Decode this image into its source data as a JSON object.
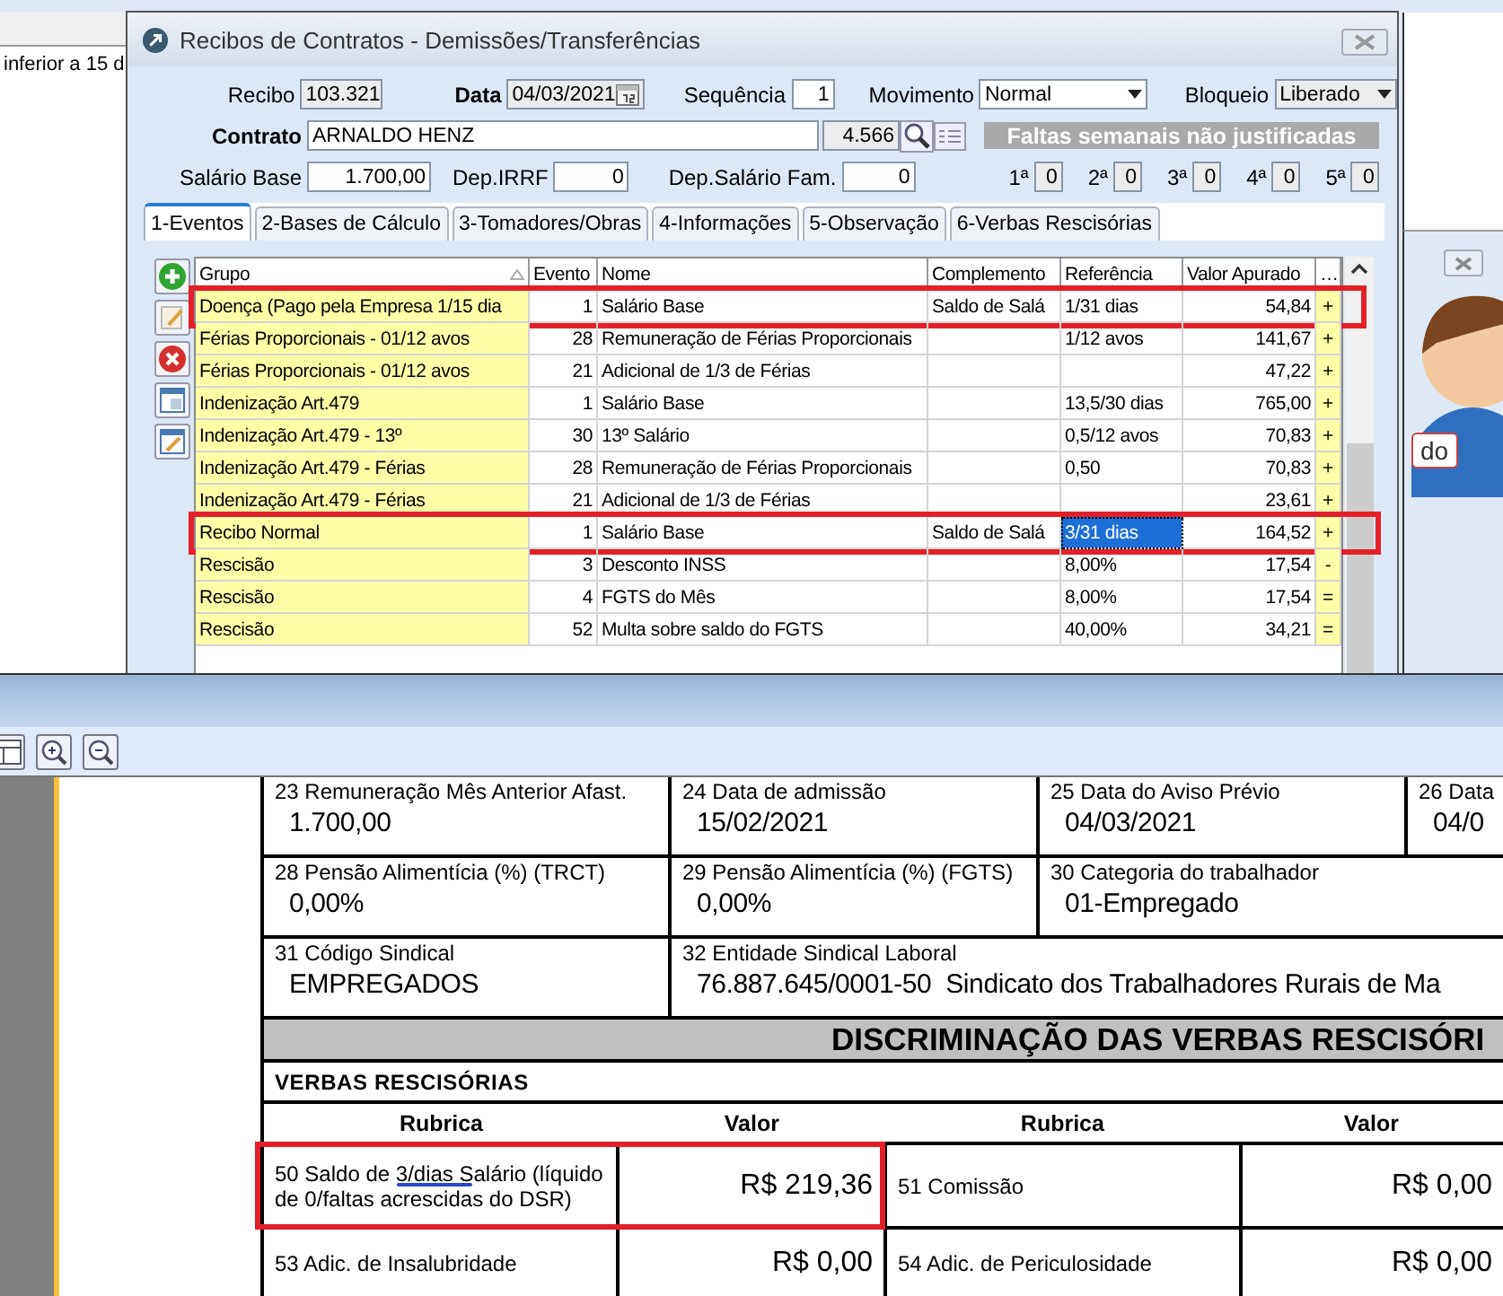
{
  "background_app": {
    "row_text": "inferior a 15 d",
    "badge_text": "do"
  },
  "dialog": {
    "title": "Recibos de Contratos - Demissões/Transferências",
    "recibo": {
      "label": "Recibo",
      "value": "103.321"
    },
    "data": {
      "label": "Data",
      "value": "04/03/2021"
    },
    "sequencia": {
      "label": "Sequência",
      "value": "1"
    },
    "movimento": {
      "label": "Movimento",
      "value": "Normal"
    },
    "bloqueio": {
      "label": "Bloqueio",
      "value": "Liberado"
    },
    "contrato": {
      "label": "Contrato",
      "value": "ARNALDO HENZ",
      "code": "4.566"
    },
    "salario_base": {
      "label": "Salário Base",
      "value": "1.700,00"
    },
    "dep_irrf": {
      "label": "Dep.IRRF",
      "value": "0"
    },
    "dep_salario_fam": {
      "label": "Dep.Salário Fam.",
      "value": "0"
    },
    "faltas": {
      "title": "Faltas semanais não justificadas",
      "weeks": [
        {
          "label": "1ª",
          "value": "0"
        },
        {
          "label": "2ª",
          "value": "0"
        },
        {
          "label": "3ª",
          "value": "0"
        },
        {
          "label": "4ª",
          "value": "0"
        },
        {
          "label": "5ª",
          "value": "0"
        }
      ]
    },
    "tabs": [
      {
        "label": "1-Eventos",
        "selected": true
      },
      {
        "label": "2-Bases de Cálculo",
        "selected": false
      },
      {
        "label": "3-Tomadores/Obras",
        "selected": false
      },
      {
        "label": "4-Informações",
        "selected": false
      },
      {
        "label": "5-Observação",
        "selected": false
      },
      {
        "label": "6-Verbas Rescisórias",
        "selected": false
      }
    ],
    "grid": {
      "columns": [
        "Grupo",
        "Evento",
        "Nome",
        "Complemento",
        "Referência",
        "Valor Apurado",
        "…"
      ],
      "rows": [
        {
          "grupo": "Doença (Pago pela Empresa 1/15 dia",
          "evento": "1",
          "nome": "Salário Base",
          "complemento": "Saldo de Salá",
          "referencia": "1/31 dias",
          "valor": "54,84",
          "sinal": "+",
          "highlighted": true,
          "selected": false
        },
        {
          "grupo": "Férias Proporcionais - 01/12 avos",
          "evento": "28",
          "nome": "Remuneração de Férias Proporcionais",
          "referencia": "1/12 avos",
          "valor": "141,67",
          "sinal": "+",
          "highlighted": false,
          "selected": false
        },
        {
          "grupo": "Férias Proporcionais - 01/12 avos",
          "evento": "21",
          "nome": "Adicional de 1/3 de Férias",
          "valor": "47,22",
          "sinal": "+",
          "highlighted": false,
          "selected": false
        },
        {
          "grupo": "Indenização Art.479",
          "evento": "1",
          "nome": "Salário Base",
          "referencia": "13,5/30 dias",
          "valor": "765,00",
          "sinal": "+",
          "highlighted": false,
          "selected": false
        },
        {
          "grupo": "Indenização Art.479 - 13º",
          "evento": "30",
          "nome": "13º Salário",
          "referencia": "0,5/12 avos",
          "valor": "70,83",
          "sinal": "+",
          "highlighted": false,
          "selected": false
        },
        {
          "grupo": "Indenização Art.479 - Férias",
          "evento": "28",
          "nome": "Remuneração de Férias Proporcionais",
          "referencia": "0,50",
          "valor": "70,83",
          "sinal": "+",
          "highlighted": false,
          "selected": false
        },
        {
          "grupo": "Indenização Art.479 - Férias",
          "evento": "21",
          "nome": "Adicional de 1/3 de Férias",
          "valor": "23,61",
          "sinal": "+",
          "highlighted": false,
          "selected": false
        },
        {
          "grupo": "Recibo Normal",
          "evento": "1",
          "nome": "Salário Base",
          "complemento": "Saldo de Salá",
          "referencia": "3/31 dias",
          "valor": "164,52",
          "sinal": "+",
          "highlighted": true,
          "selected": true
        },
        {
          "grupo": "Rescisão",
          "evento": "3",
          "nome": "Desconto INSS",
          "referencia": "8,00%",
          "valor": "17,54",
          "sinal": "-",
          "highlighted": false,
          "selected": false
        },
        {
          "grupo": "Rescisão",
          "evento": "4",
          "nome": "FGTS do Mês",
          "referencia": "8,00%",
          "valor": "17,54",
          "sinal": "=",
          "highlighted": false,
          "selected": false
        },
        {
          "grupo": "Rescisão",
          "evento": "52",
          "nome": "Multa sobre saldo do FGTS",
          "referencia": "40,00%",
          "valor": "34,21",
          "sinal": "=",
          "highlighted": false,
          "selected": false
        }
      ]
    }
  },
  "document": {
    "field_rows": [
      [
        {
          "label": "23 Remuneração Mês Anterior Afast.",
          "value": "1.700,00"
        },
        {
          "label": "24 Data de admissão",
          "value": "15/02/2021"
        },
        {
          "label": "25 Data do Aviso Prévio",
          "value": "04/03/2021"
        },
        {
          "label": "26 Data",
          "value": "04/0"
        }
      ],
      [
        {
          "label": "28 Pensão Alimentícia (%) (TRCT)",
          "value": "0,00%"
        },
        {
          "label": "29 Pensão Alimentícia (%) (FGTS)",
          "value": "0,00%"
        },
        {
          "label": "30 Categoria do trabalhador",
          "value": "01-Empregado"
        }
      ],
      [
        {
          "label": "31 Código Sindical",
          "value": "EMPREGADOS"
        },
        {
          "label": "32 Entidade Sindical Laboral",
          "value": "76.887.645/0001-50  Sindicato dos Trabalhadores Rurais de Ma"
        }
      ]
    ],
    "section_title": "DISCRIMINAÇÃO DAS VERBAS RESCISÓRI",
    "subsection_title": "VERBAS RESCISÓRIAS",
    "columns": [
      "Rubrica",
      "Valor",
      "Rubrica",
      "Valor"
    ],
    "items": [
      {
        "left": {
          "rubrica": "50 Saldo de 3/dias Salário (líquido de 0/faltas acrescidas do DSR)",
          "valor": "R$ 219,36",
          "highlighted": true,
          "pen_mark": true
        },
        "right": {
          "rubrica": "51 Comissão",
          "valor": "R$ 0,00"
        }
      },
      {
        "left": {
          "rubrica": "53 Adic. de Insalubridade",
          "valor": "R$ 0,00",
          "highlighted": false,
          "pen_mark": false
        },
        "right": {
          "rubrica": "54 Adic. de Periculosidade",
          "valor": "R$ 0,00"
        }
      }
    ]
  }
}
